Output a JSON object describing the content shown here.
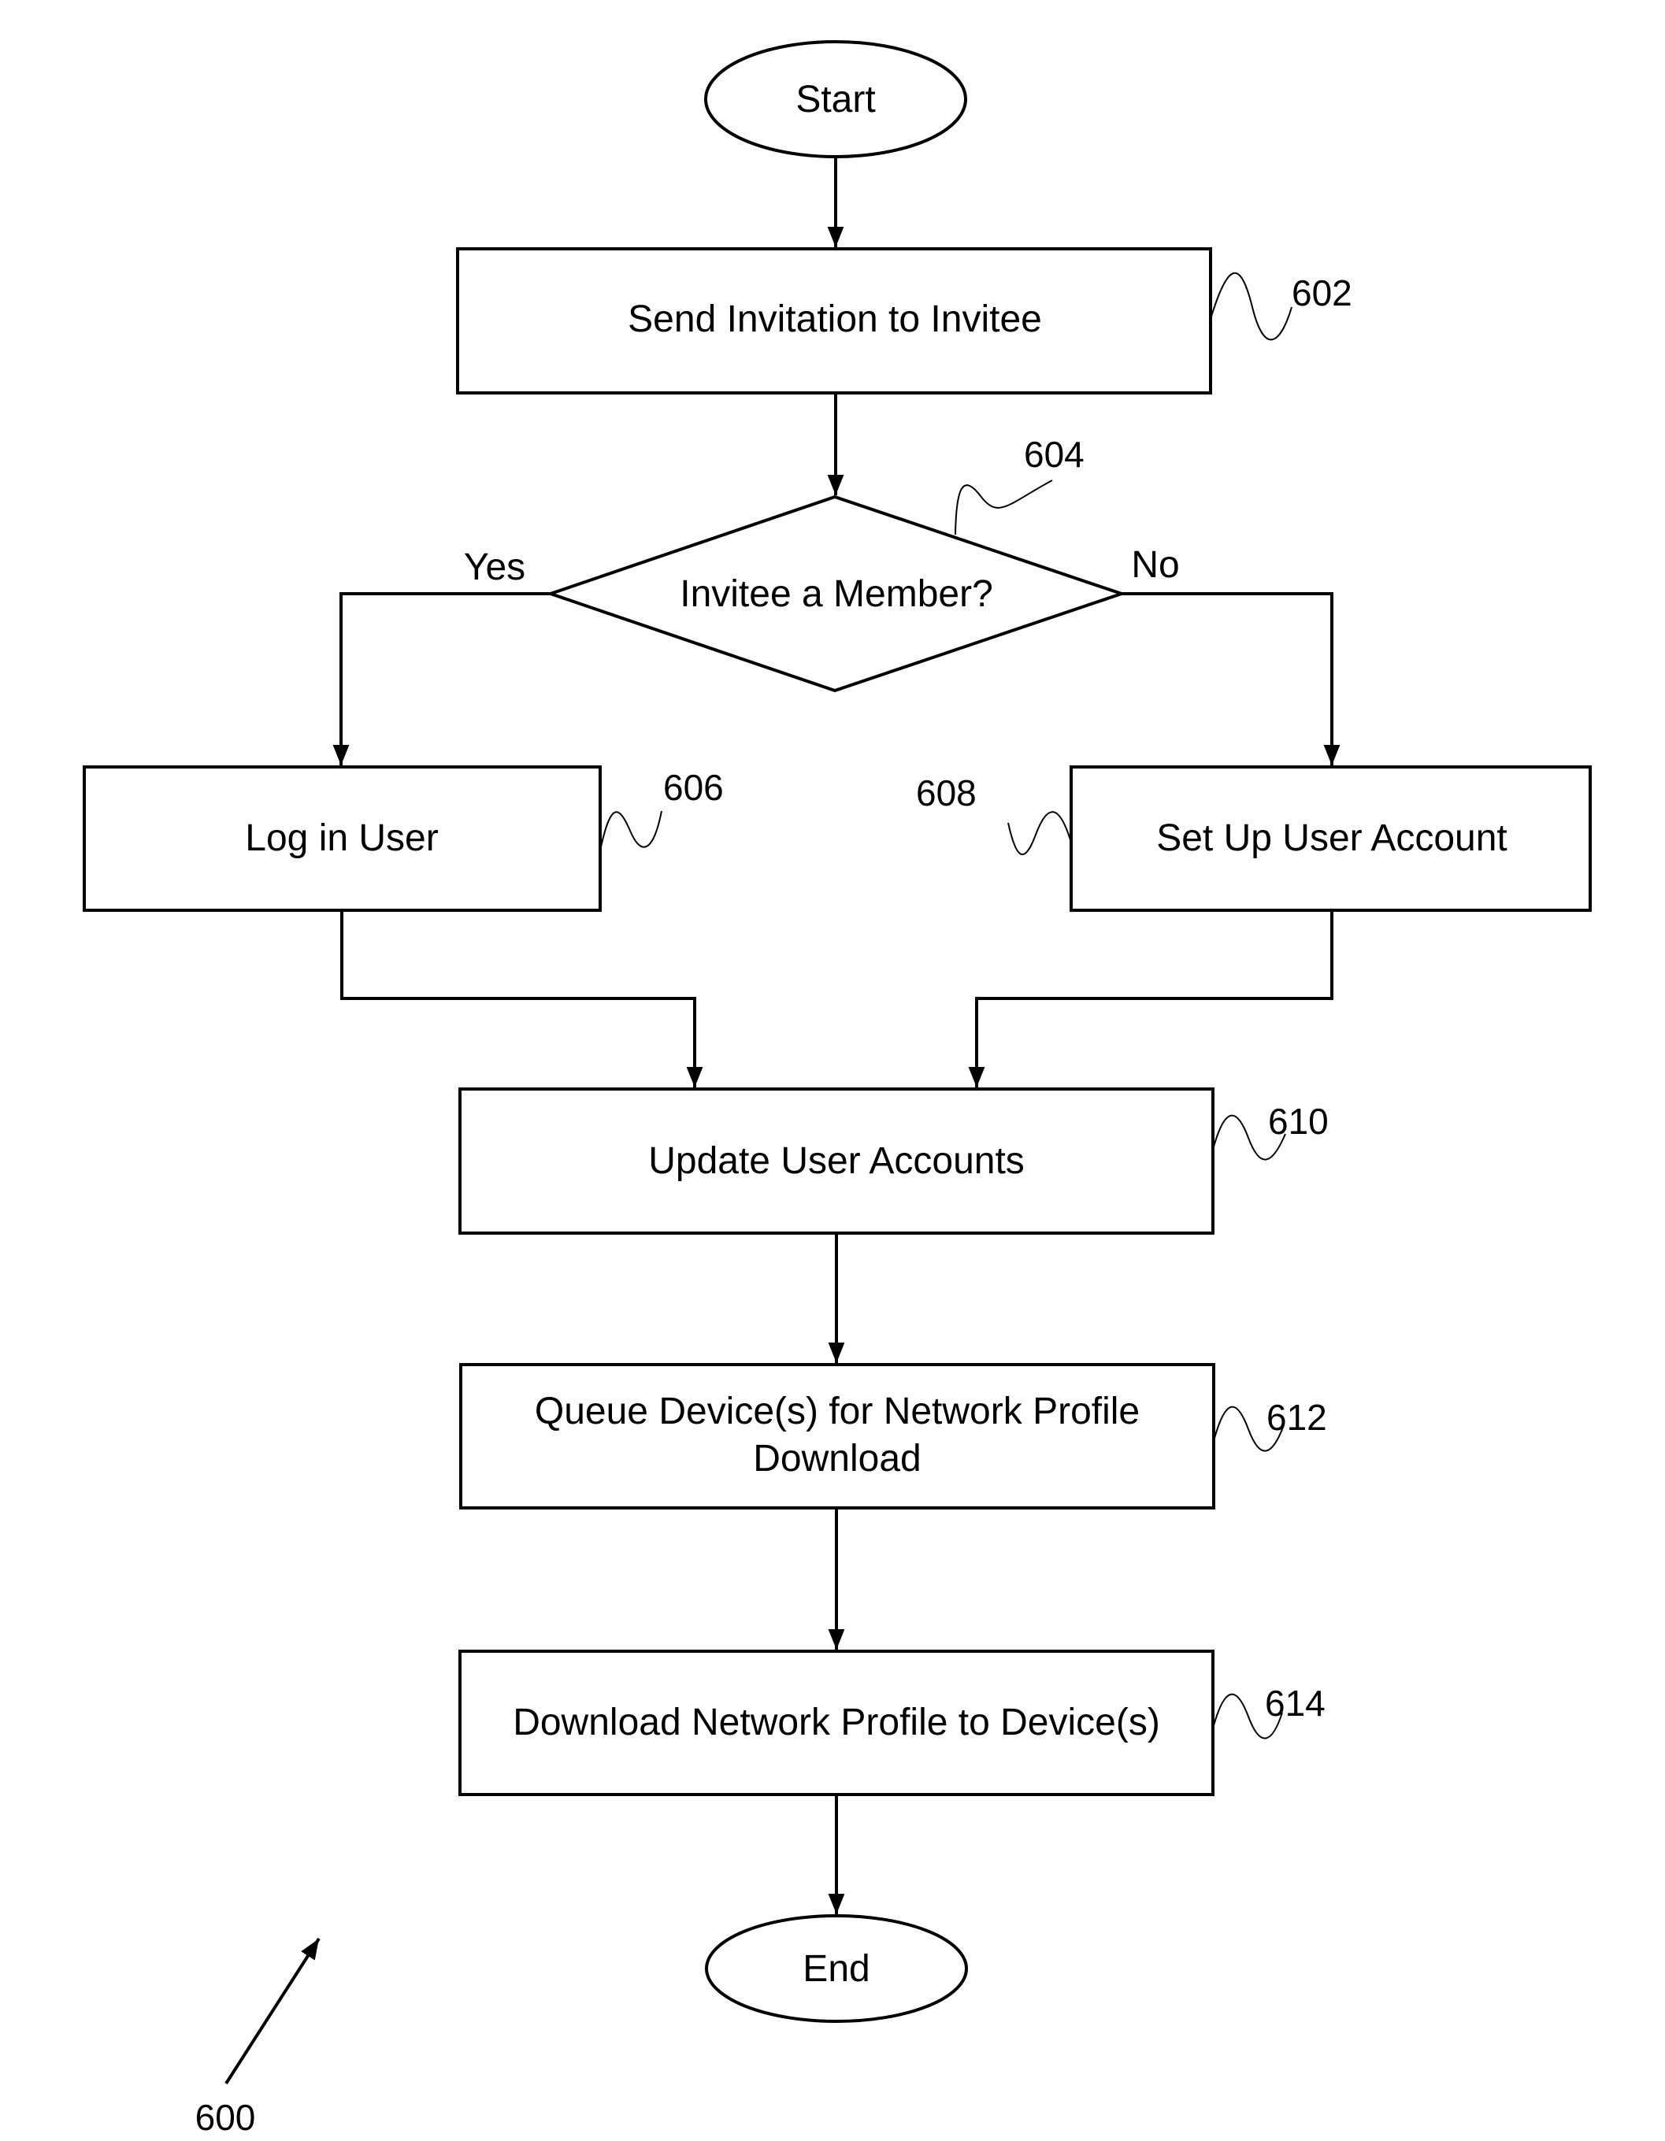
{
  "figure": {
    "reference": "600",
    "nodes": {
      "start": {
        "label": "Start",
        "type": "terminator"
      },
      "n602": {
        "label": "Send Invitation to Invitee",
        "ref": "602",
        "type": "process"
      },
      "n604": {
        "label": "Invitee a Member?",
        "ref": "604",
        "type": "decision"
      },
      "n606": {
        "label": "Log in User",
        "ref": "606",
        "type": "process"
      },
      "n608": {
        "label": "Set Up User Account",
        "ref": "608",
        "type": "process"
      },
      "n610": {
        "label": "Update User Accounts",
        "ref": "610",
        "type": "process"
      },
      "n612": {
        "label_line1": "Queue Device(s) for Network Profile",
        "label_line2": "Download",
        "ref": "612",
        "type": "process"
      },
      "n614": {
        "label": "Download Network Profile to Device(s)",
        "ref": "614",
        "type": "process"
      },
      "end": {
        "label": "End",
        "type": "terminator"
      }
    },
    "branches": {
      "yes": "Yes",
      "no": "No"
    },
    "edges": [
      {
        "from": "start",
        "to": "n602"
      },
      {
        "from": "n602",
        "to": "n604"
      },
      {
        "from": "n604",
        "to": "n606",
        "label": "Yes"
      },
      {
        "from": "n604",
        "to": "n608",
        "label": "No"
      },
      {
        "from": "n606",
        "to": "n610"
      },
      {
        "from": "n608",
        "to": "n610"
      },
      {
        "from": "n610",
        "to": "n612"
      },
      {
        "from": "n612",
        "to": "n614"
      },
      {
        "from": "n614",
        "to": "end"
      }
    ]
  }
}
